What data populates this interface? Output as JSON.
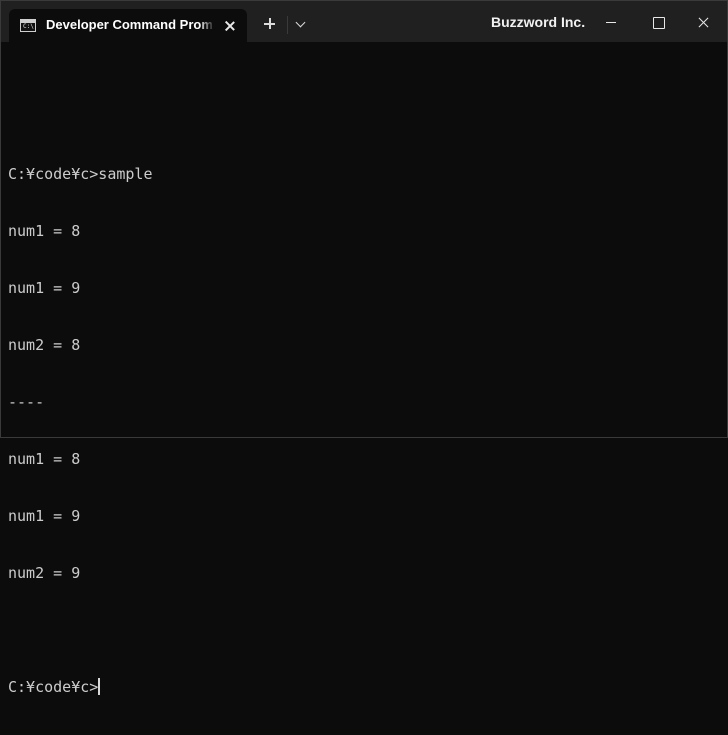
{
  "titlebar": {
    "tab_title": "Developer Command Prompt",
    "brand": "Buzzword Inc."
  },
  "icons": {
    "tab": "console-icon",
    "tab_close": "close-icon",
    "new_tab": "plus-icon",
    "dropdown": "chevron-down-icon",
    "minimize": "minimize-icon",
    "maximize": "maximize-icon",
    "close": "close-icon"
  },
  "terminal": {
    "lines": [
      "",
      "C:¥code¥c>sample",
      "num1 = 8",
      "num1 = 9",
      "num2 = 8",
      "----",
      "num1 = 8",
      "num1 = 9",
      "num2 = 9",
      "",
      "C:¥code¥c>"
    ]
  },
  "colors": {
    "background": "#0c0c0c",
    "titlebar": "#202020",
    "text": "#cccccc"
  }
}
